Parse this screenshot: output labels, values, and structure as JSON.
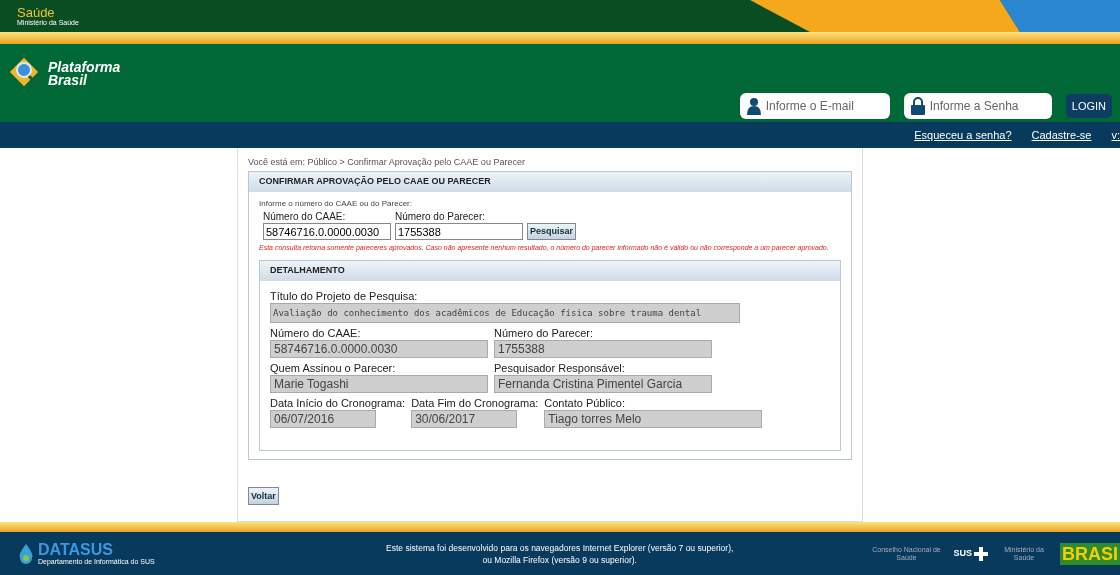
{
  "top_bar": {
    "title": "Saúde",
    "subtitle": "Ministério da Saúde"
  },
  "header": {
    "logo_lines": [
      "Plataforma",
      "Brasil"
    ],
    "email_field": {
      "placeholder": "Informe o E-mail"
    },
    "password_field": {
      "placeholder": "Informe a Senha"
    },
    "login_button": "LOGIN"
  },
  "nav_links": [
    "Esqueceu a senha?",
    "Cadastre-se",
    "v:"
  ],
  "breadcrumb": "Você está em: Público > Confirmar Aprovação pelo CAAE ou Parecer",
  "search_panel": {
    "title": "CONFIRMAR APROVAÇÃO PELO CAAE OU PARECER",
    "instruction": "Informe o número do CAAE ou do Parecer:",
    "fields": [
      {
        "label": "Número do CAAE:",
        "value": "58746716.0.0000.0030"
      },
      {
        "label": "Número do Parecer:",
        "value": "1755388"
      }
    ],
    "search_button": "Pesquisar",
    "notice": "Esta consulta retorna somente pareceres aprovados. Caso não apresente nenhum resultado, o número do parecer informado não é válido ou não corresponde a um parecer aprovado."
  },
  "details": {
    "title": "DETALHAMENTO",
    "project_title": {
      "label": "Título do Projeto de Pesquisa:",
      "value": "Avaliação do conhecimento dos acadêmicos de Educação física sobre trauma dental"
    },
    "rows": [
      [
        {
          "label": "Número do CAAE:",
          "value": "58746716.0.0000.0030",
          "kind": "wide"
        },
        {
          "label": "Número do Parecer:",
          "value": "1755388",
          "kind": "wide"
        }
      ],
      [
        {
          "label": "Quem Assinou o Parecer:",
          "value": "Marie Togashi",
          "kind": "wide"
        },
        {
          "label": "Pesquisador Responsável:",
          "value": "Fernanda Cristina Pimentel Garcia",
          "kind": "wide"
        }
      ],
      [
        {
          "label": "Data Início do Cronograma:",
          "value": "06/07/2016",
          "kind": "narrow"
        },
        {
          "label": "Data Fim do Cronograma:",
          "value": "30/06/2017",
          "kind": "narrow"
        },
        {
          "label": "Contato Público:",
          "value": "Tiago torres Melo",
          "kind": "wide"
        }
      ]
    ]
  },
  "back_button": "Voltar",
  "footer": {
    "brand": "DATASUS",
    "brand_sub": "Departamento de Informática do SUS",
    "message": [
      "Este sistema foi desenvolvido para os navegadores Internet Explorer (versão 7 ou superior),",
      "ou Mozilla Firefox (versão 9 ou superior)."
    ],
    "partner_1": "Conselho Nacional de Saúde",
    "partner_2": "SUS",
    "partner_3": "Ministério da Saúde",
    "gov_logo": "BRASI"
  }
}
